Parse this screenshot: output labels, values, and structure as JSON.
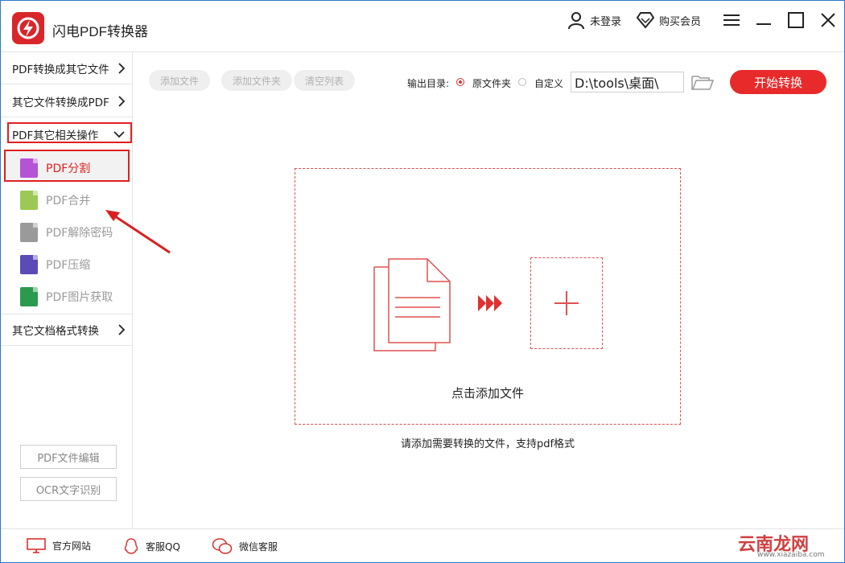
{
  "app": {
    "title": "闪电PDF转换器"
  },
  "header": {
    "login": "未登录",
    "buy": "购买会员"
  },
  "sidebar": {
    "categories": [
      {
        "label": "PDF转换成其它文件"
      },
      {
        "label": "其它文件转换成PDF"
      },
      {
        "label": "PDF其它相关操作"
      },
      {
        "label": "其它文档格式转换"
      }
    ],
    "sub_items": [
      {
        "label": "PDF分割",
        "color": "#b553d6"
      },
      {
        "label": "PDF合并",
        "color": "#9cc956"
      },
      {
        "label": "PDF解除密码",
        "color": "#9a9a9a"
      },
      {
        "label": "PDF压缩",
        "color": "#5b4bb8"
      },
      {
        "label": "PDF图片获取",
        "color": "#2c9a4e"
      }
    ],
    "bottom_buttons": [
      "PDF文件编辑",
      "OCR文字识别"
    ]
  },
  "toolbar": {
    "add_file": "添加文件",
    "add_folder": "添加文件夹",
    "clear_list": "清空列表",
    "output_label": "输出目录:",
    "option_original": "原文件夹",
    "option_custom": "自定义",
    "path_value": "D:\\tools\\桌面\\",
    "start": "开始转换"
  },
  "dropzone": {
    "text": "点击添加文件",
    "hint": "请添加需要转换的文件，支持pdf格式"
  },
  "footer": {
    "website": "官方网站",
    "qq": "客服QQ",
    "wechat": "微信客服"
  },
  "watermark": {
    "main": "云南龙网",
    "sub": "www.xiazaiba.com"
  },
  "colors": {
    "accent": "#e82a2a",
    "highlight": "#e02020"
  }
}
